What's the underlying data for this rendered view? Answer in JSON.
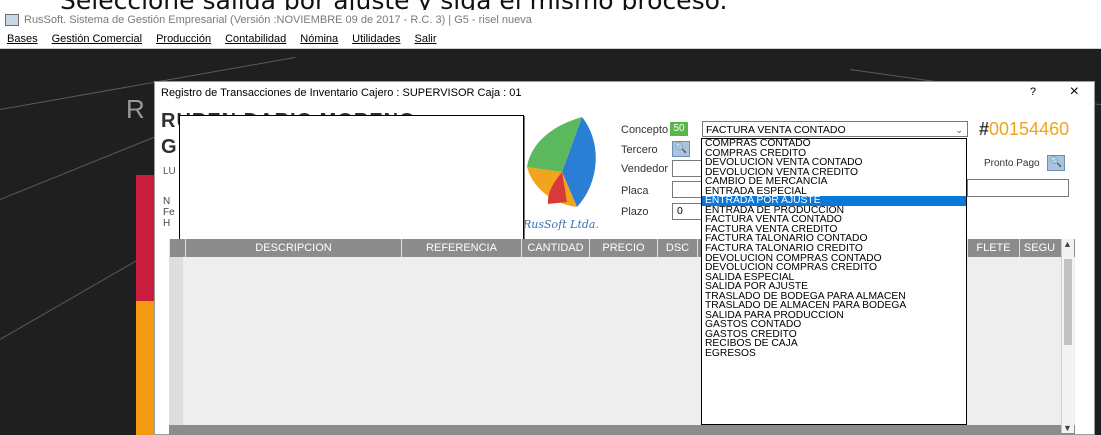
{
  "banner_text": "Seleccione salida por ajuste y siga el mismo proceso.",
  "titlebar": {
    "text": "RusSoft. Sistema de Gestión Empresarial (Versión :NOVIEMBRE 09 de 2017 - R.C. 3) | G5 - risel nueva"
  },
  "menu": [
    "Bases",
    "Gestión Comercial",
    "Producción",
    "Contabilidad",
    "Nómina",
    "Utilidades",
    "Salir"
  ],
  "dialog": {
    "title": "Registro de Transacciones de Inventario   Cajero : SUPERVISOR   Caja : 01",
    "help": "?",
    "close": "×"
  },
  "company": {
    "line1": "RUBEN DARIO MORENO",
    "line2": "G",
    "line3": "LU",
    "n_label": "N",
    "fe_label": "Fe",
    "ho_label": "H"
  },
  "logo_text": "RusSoft Ltda.",
  "form": {
    "concepto_label": "Concepto",
    "concepto_code": "50",
    "concepto_value": "FACTURA VENTA CONTADO",
    "tercero_label": "Tercero",
    "vendedor_label": "Vendedor",
    "placa_label": "Placa",
    "plazo_label": "Plazo",
    "plazo_value": "0",
    "doc_hash": "#",
    "doc_number": "00154460",
    "pronto_pago_label": "Pronto Pago"
  },
  "grid": {
    "columns": [
      "",
      "DESCRIPCION",
      "REFERENCIA",
      "CANTIDAD",
      "PRECIO",
      "DSC",
      "",
      "",
      "FLETE",
      "SEGU"
    ]
  },
  "dropdown": {
    "selected_index": 6,
    "options": [
      "COMPRAS CONTADO",
      "COMPRAS CREDITO",
      "DEVOLUCION VENTA CONTADO",
      "DEVOLUCION VENTA CREDITO",
      "CAMBIO DE MERCANCIA",
      "ENTRADA ESPECIAL",
      "ENTRADA POR AJUSTE",
      "ENTRADA DE PRODUCCION",
      "FACTURA VENTA CONTADO",
      "FACTURA VENTA CREDITO",
      "FACTURA TALONARIO CONTADO",
      "FACTURA TALONARIO CREDITO",
      "DEVOLUCION COMPRAS CONTADO",
      "DEVOLUCION COMPRAS CREDITO",
      "SALIDA ESPECIAL",
      "SALIDA POR AJUSTE",
      "TRASLADO DE BODEGA PARA ALMACEN",
      "TRASLADO DE ALMACEN PARA BODEGA",
      "SALIDA PARA PRODUCCION",
      "GASTOS CONTADO",
      "GASTOS CREDITO",
      "RECIBOS DE CAJA",
      "EGRESOS"
    ]
  },
  "colors": {
    "accent": "#0a78d7",
    "doc_number": "#f1a31b",
    "concepto_badge": "#57b847",
    "red_block": "#c81d3c",
    "orange_block": "#f29a12"
  }
}
